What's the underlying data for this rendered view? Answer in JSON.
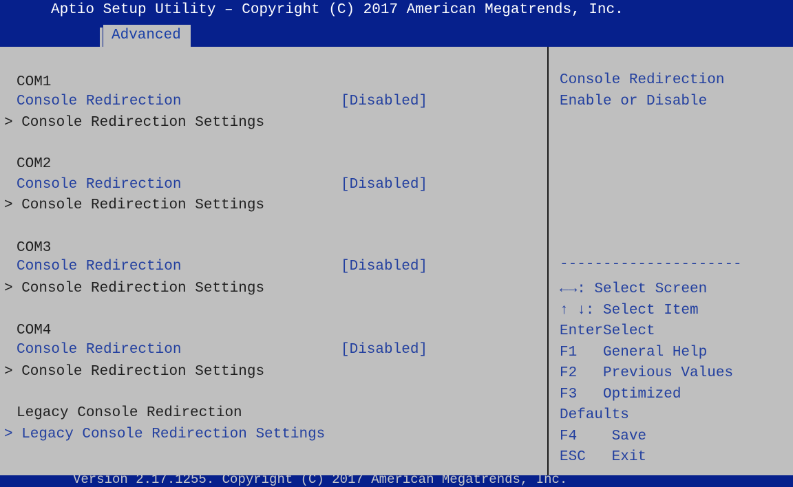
{
  "header": {
    "title": "Aptio Setup Utility – Copyright (C) 2017 American Megatrends, Inc.",
    "active_tab": "Advanced"
  },
  "main": {
    "groups": [
      {
        "heading": "COM1",
        "option_label": "Console Redirection",
        "option_value": "[Disabled]",
        "submenu": "> Console Redirection Settings"
      },
      {
        "heading": "COM2",
        "option_label": "Console Redirection",
        "option_value": "[Disabled]",
        "submenu": "> Console Redirection Settings"
      },
      {
        "heading": "COM3",
        "option_label": "Console Redirection",
        "option_value": "[Disabled]",
        "submenu": "> Console Redirection Settings"
      },
      {
        "heading": "COM4",
        "option_label": "Console Redirection",
        "option_value": "[Disabled]",
        "submenu": "> Console Redirection Settings"
      }
    ],
    "legacy": {
      "heading": "Legacy Console Redirection",
      "submenu": "> Legacy Console Redirection Settings"
    }
  },
  "help": {
    "title": "Console Redirection",
    "description": "Enable or Disable",
    "separator": "---------------------",
    "keys": [
      "←→: Select Screen",
      "↑ ↓: Select Item",
      "EnterSelect",
      "F1   General Help",
      "F2   Previous Values",
      "F3   Optimized",
      "Defaults",
      "F4    Save",
      "ESC   Exit"
    ]
  },
  "footer": {
    "version": "Version 2.17.1255. Copyright (C) 2017 American Megatrends, Inc."
  },
  "colors": {
    "header_bg": "#06208c",
    "panel_bg": "#bfbfbf",
    "accent_text": "#223f9f"
  }
}
